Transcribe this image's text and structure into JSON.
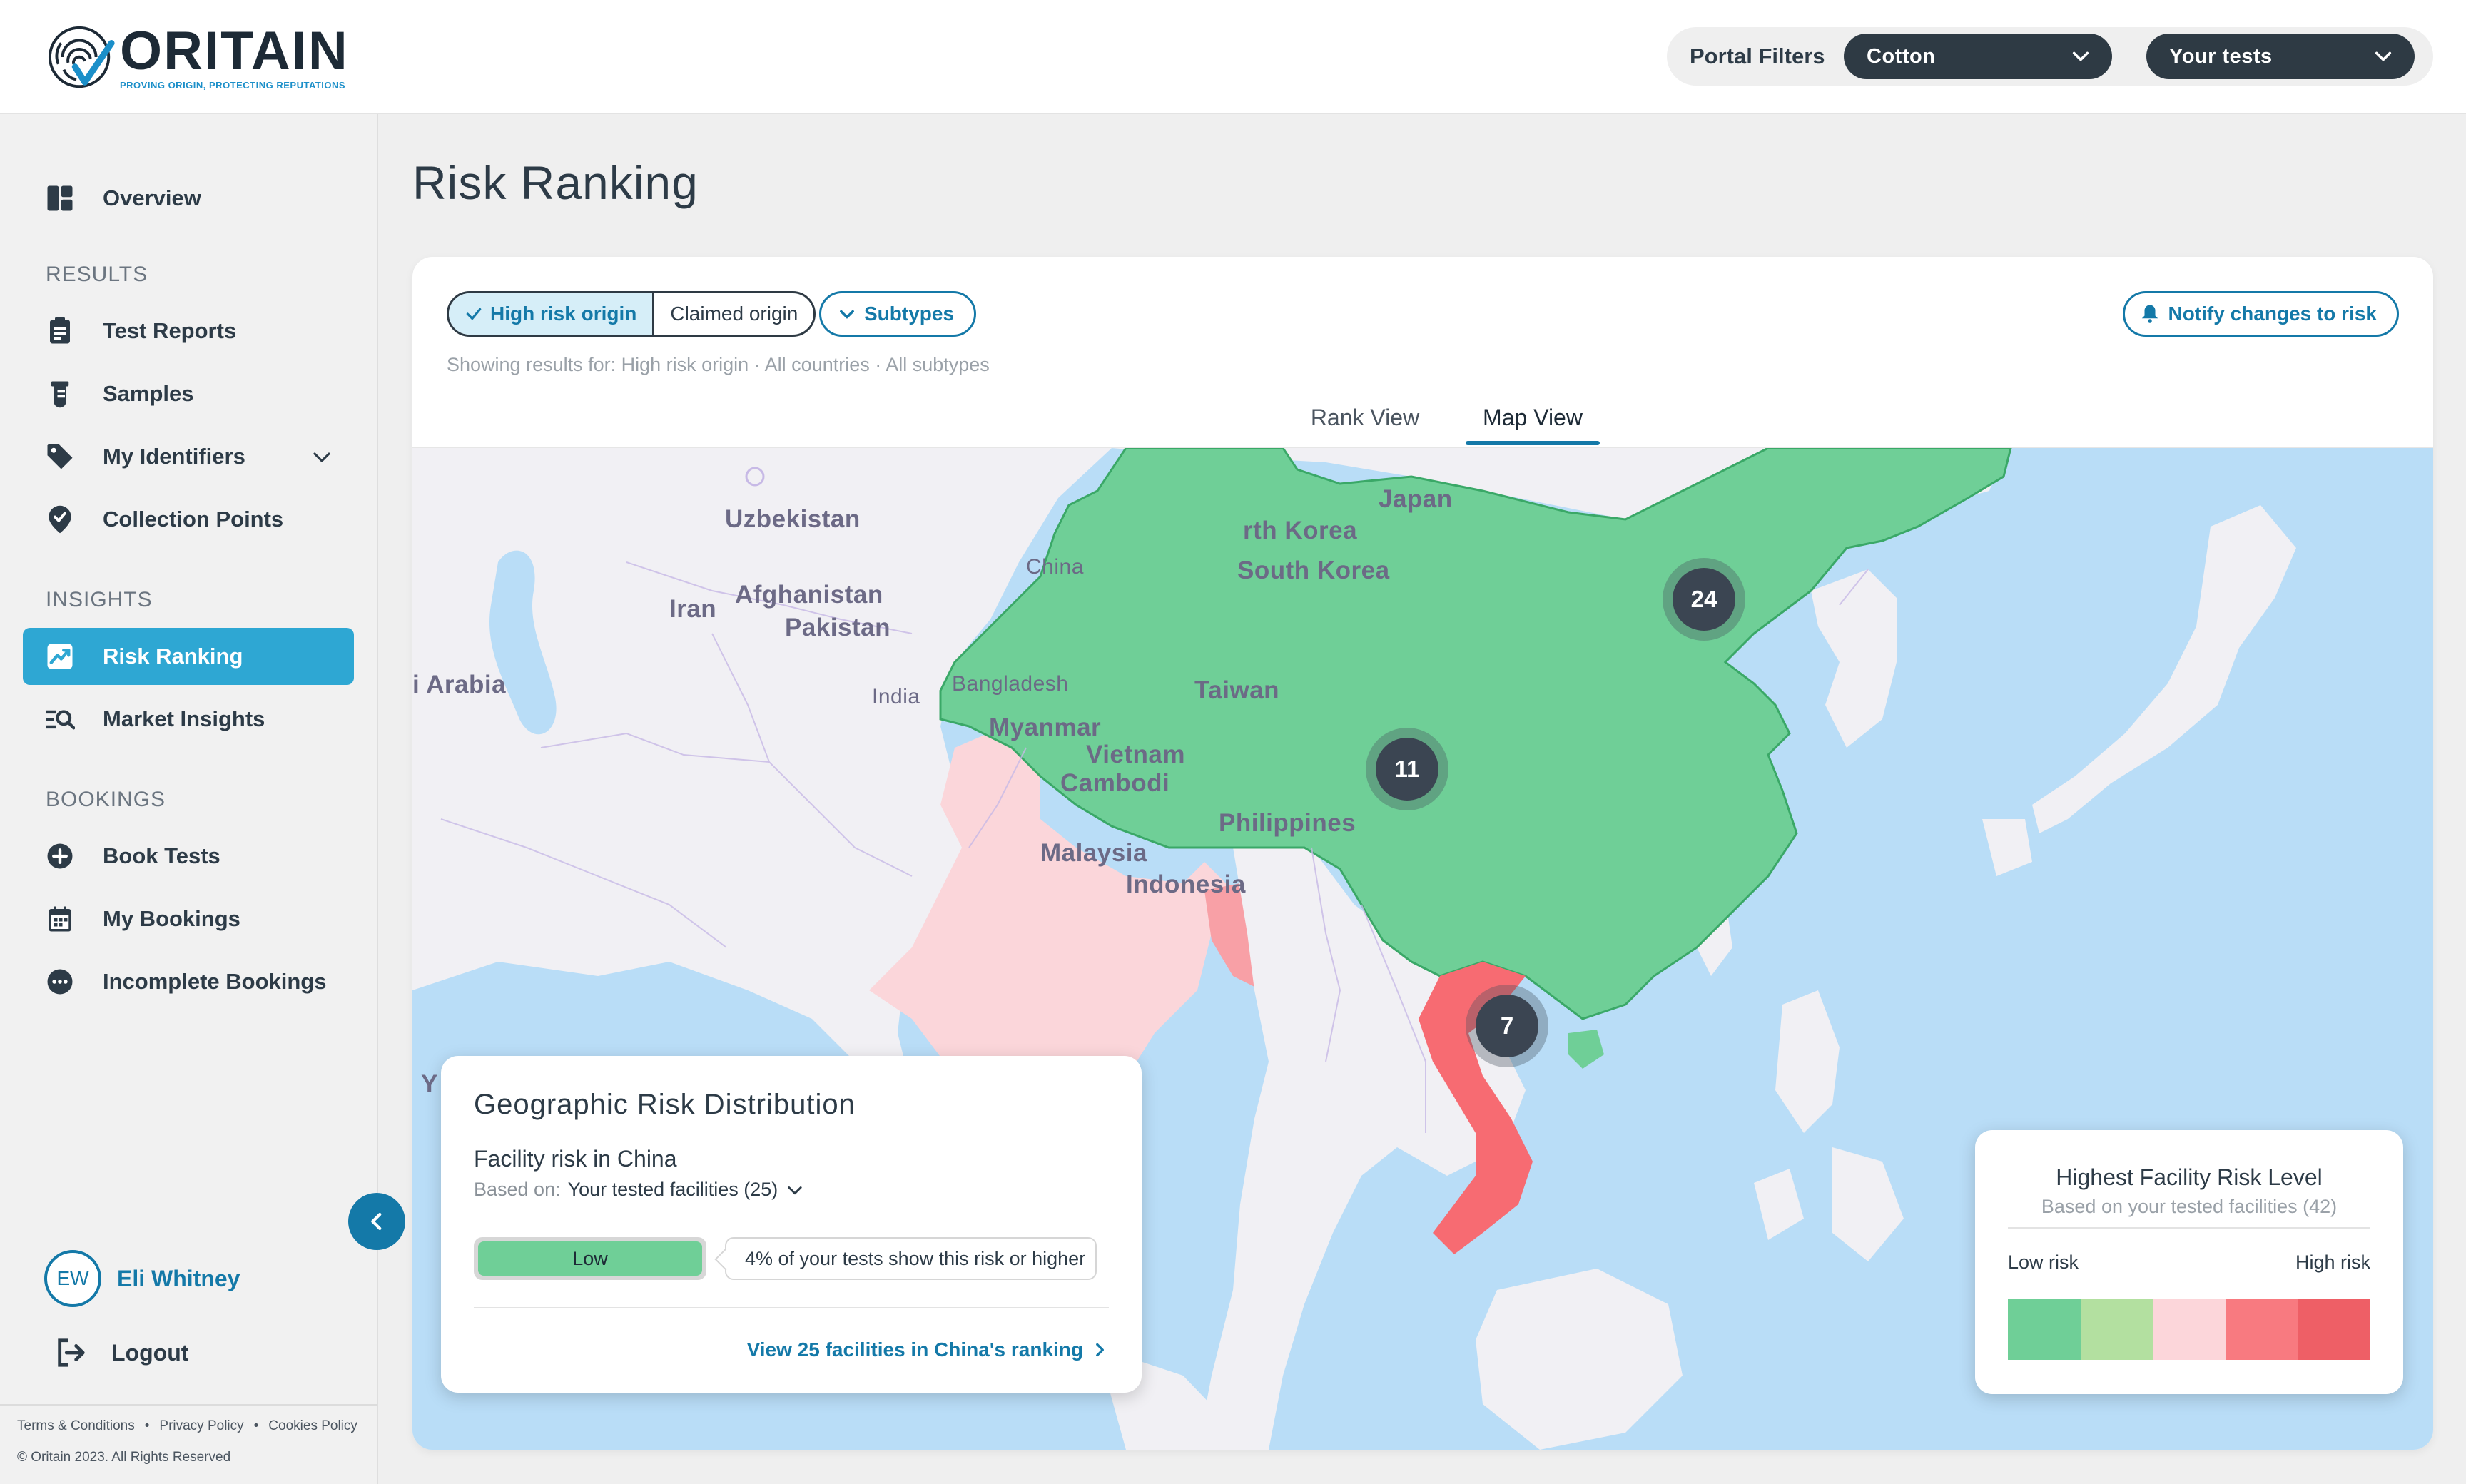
{
  "brand": {
    "name": "ORITAIN",
    "tagline": "PROVING ORIGIN, PROTECTING REPUTATIONS"
  },
  "header": {
    "filters_label": "Portal Filters",
    "product_select": "Cotton",
    "tests_select": "Your tests"
  },
  "sidebar": {
    "overview": "Overview",
    "results_label": "RESULTS",
    "results": [
      "Test Reports",
      "Samples",
      "My Identifiers",
      "Collection Points"
    ],
    "insights_label": "INSIGHTS",
    "insights": [
      "Risk Ranking",
      "Market Insights"
    ],
    "bookings_label": "BOOKINGS",
    "bookings": [
      "Book Tests",
      "My Bookings",
      "Incomplete Bookings"
    ],
    "user_initials": "EW",
    "user_name": "Eli Whitney",
    "logout": "Logout",
    "legal": [
      "Terms & Conditions",
      "Privacy Policy",
      "Cookies Policy"
    ],
    "copyright": "© Oritain 2023. All Rights Reserved"
  },
  "page": {
    "title": "Risk Ranking",
    "toggle_on": "High risk origin",
    "toggle_off": "Claimed origin",
    "subtypes": "Subtypes",
    "notify": "Notify changes to risk",
    "showing": "Showing results for: High risk origin · All countries · All subtypes",
    "tabs": [
      "Rank View",
      "Map View"
    ],
    "active_tab": "Map View"
  },
  "map": {
    "labels": {
      "uzbekistan": "Uzbekistan",
      "afghanistan": "Afghanistan",
      "iran": "Iran",
      "pakistan": "Pakistan",
      "arabia": "i Arabia",
      "india": "India",
      "bangladesh": "Bangladesh",
      "myanmar": "Myanmar",
      "china": "China",
      "north_korea": "rth Korea",
      "south_korea": "South Korea",
      "japan": "Japan",
      "taiwan": "Taiwan",
      "vietnam": "Vietnam",
      "cambodia": "Cambodi",
      "philippines": "Philippines",
      "malaysia": "Malaysia",
      "indonesia": "Indonesia",
      "yemen_fragment": "Y"
    },
    "clusters": [
      {
        "label": "24"
      },
      {
        "label": "11"
      },
      {
        "label": "7"
      }
    ],
    "colors": {
      "water": "#b9ddf7",
      "land": "#f1f0f4",
      "low": "#6fcf97",
      "medium_low": "#fad4d8",
      "high": "#f76b72"
    }
  },
  "geo_panel": {
    "title": "Geographic Risk Distribution",
    "subtitle": "Facility risk in China",
    "based_on_label": "Based on:",
    "based_on_value": "Your tested facilities (25)",
    "risk_level": "Low",
    "risk_note": "4% of your tests show this risk or higher",
    "link": "View 25 facilities in China's ranking"
  },
  "legend": {
    "title": "Highest Facility Risk Level",
    "subtitle": "Based on your tested facilities (42)",
    "low_label": "Low risk",
    "high_label": "High risk",
    "colors": [
      "#6fcf97",
      "#b3e0a0",
      "#fcd6da",
      "#f87a80",
      "#ee5f66"
    ]
  }
}
